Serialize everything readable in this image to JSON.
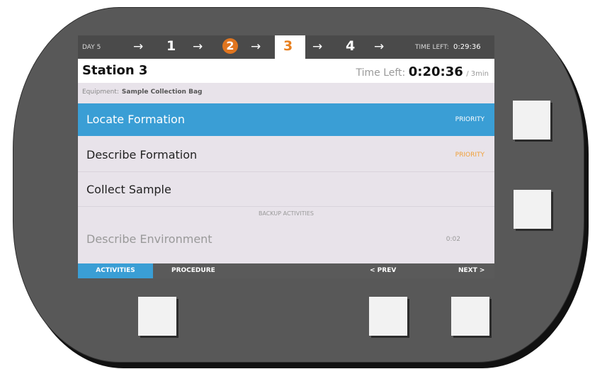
{
  "stepbar": {
    "day": "DAY 5",
    "arrow": "→",
    "steps": [
      "1",
      "2",
      "3",
      "4"
    ],
    "active_step": "2",
    "current_step": "3",
    "time_left_label": "TIME LEFT:",
    "time_left_value": "0:29:36"
  },
  "header": {
    "title": "Station 3",
    "time_left_label": "Time Left:",
    "time_left_value": "0:20:36",
    "time_left_suffix": "/ 3min"
  },
  "equipment": {
    "label": "Equipment:",
    "value": "Sample Collection Bag"
  },
  "activities": [
    {
      "label": "Locate Formation",
      "tag": "PRIORITY",
      "selected": true
    },
    {
      "label": "Describe Formation",
      "tag": "PRIORITY",
      "selected": false
    },
    {
      "label": "Collect Sample",
      "tag": "",
      "selected": false
    }
  ],
  "backup": {
    "label": "BACKUP ACTIVITIES",
    "items": [
      {
        "label": "Describe Environment",
        "tag": "0:02"
      }
    ]
  },
  "bottombar": {
    "activities": "ACTIVITIES",
    "procedure": "PROCEDURE",
    "prev": "< PREV",
    "next": "NEXT >"
  },
  "colors": {
    "accent": "#3a9ed5",
    "priority": "#f0a03a",
    "step_active": "#e0751f"
  }
}
